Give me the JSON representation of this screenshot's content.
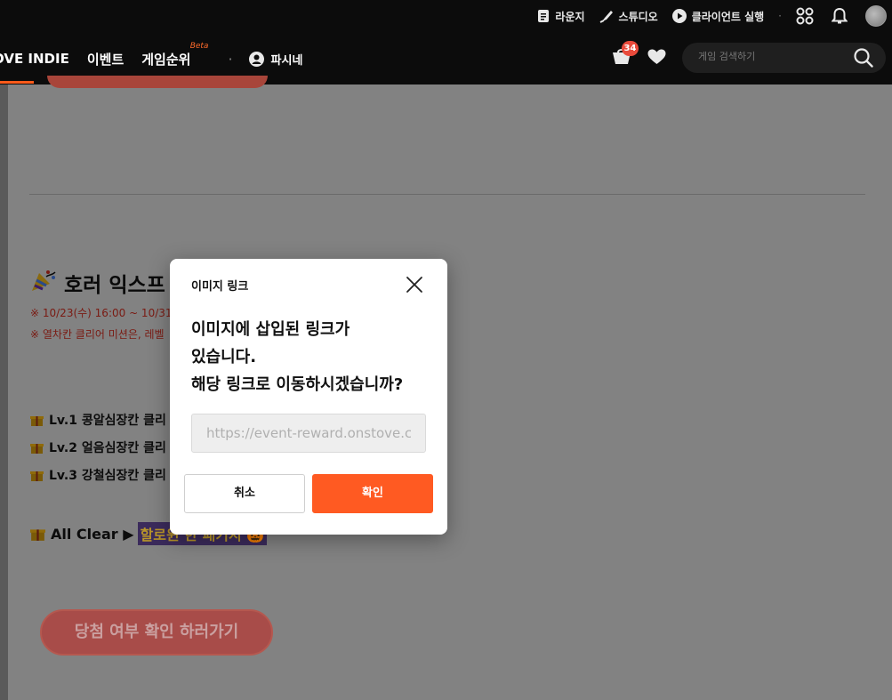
{
  "header": {
    "utility": {
      "lounge": "라운지",
      "studio": "스튜디오",
      "client_run": "클라이언트 실행",
      "separator": "·"
    },
    "nav": {
      "brand": "OVE INDIE",
      "event": "이벤트",
      "ranking": "게임순위",
      "ranking_badge": "Beta",
      "separator": "·",
      "username": "파시네"
    },
    "cart_count": "34",
    "search": {
      "placeholder": "게임 검색하기"
    }
  },
  "content": {
    "section_title": "호러 익스프",
    "notes": [
      "※ 10/23(수) 16:00 ~ 10/31",
      "※ 열차칸 클리어 미션은, 레벨"
    ],
    "rewards": [
      "Lv.1 콩알심장칸 클리",
      "Lv.2 얼음심장칸 클리",
      "Lv.3 강철심장칸 클리"
    ],
    "all_clear_label": "All Clear ▶",
    "all_clear_highlight": "할로윈 한 패키지 🎃",
    "cta_label": "당첨 여부 확인 하러가기"
  },
  "modal": {
    "title": "이미지 링크",
    "message_lines": [
      "이미지에 삽입된 링크가",
      "있습니다.",
      "해당 링크로 이동하시겠습니까?"
    ],
    "url_value": "https://event-reward.onstove.com",
    "cancel_label": "취소",
    "confirm_label": "확인"
  },
  "colors": {
    "accent": "#ff5a22",
    "header_bg": "#0c0c0c",
    "overlay_content": "#828282",
    "badge": "#e94a3b"
  },
  "icons": [
    "lounge-icon",
    "studio-icon",
    "play-icon",
    "apps-grid-icon",
    "bell-icon",
    "user-icon",
    "cart-icon",
    "heart-icon",
    "search-icon",
    "close-icon",
    "gift-icon",
    "party-popper-icon"
  ]
}
